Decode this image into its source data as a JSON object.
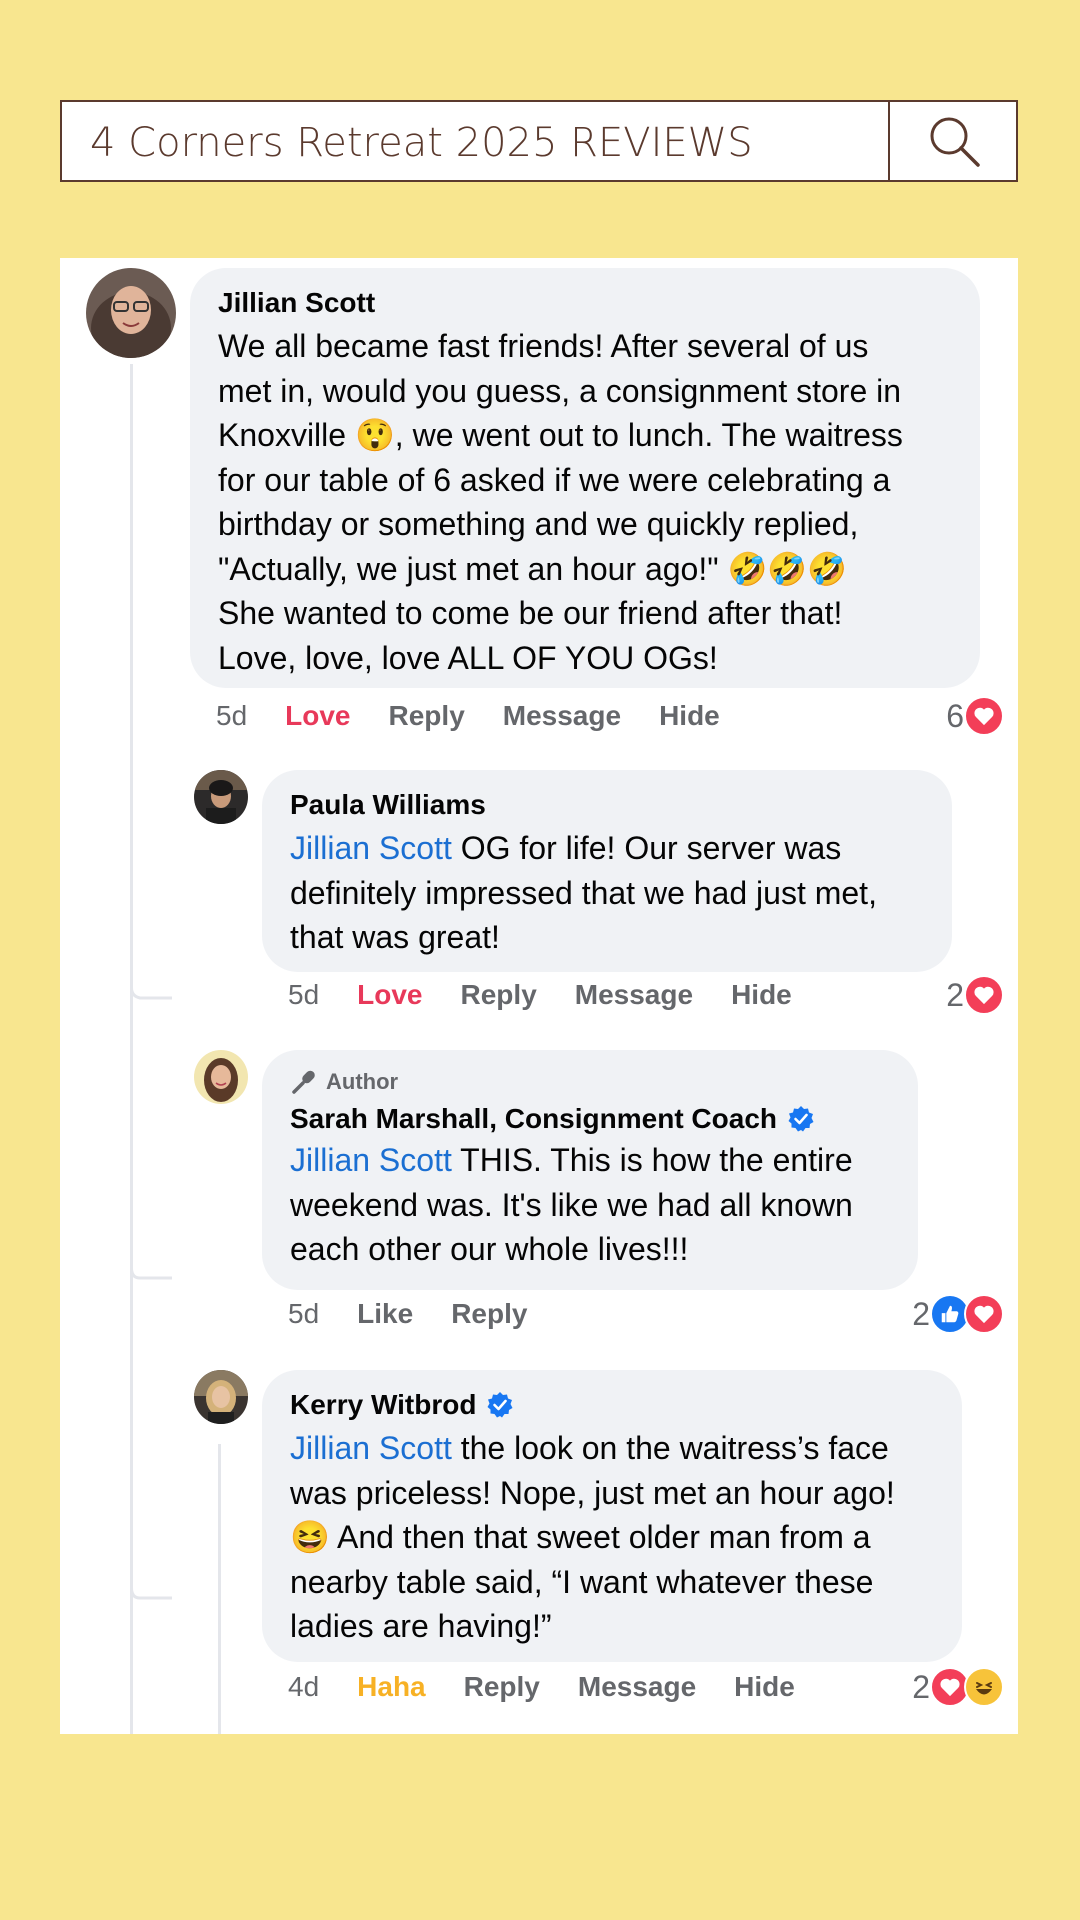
{
  "search": {
    "text": "4 Corners Retreat 2025 REVIEWS"
  },
  "comments": [
    {
      "name": "Jillian Scott",
      "body_lines": [
        "We all became fast friends! After several of us",
        "met in, would you guess, a consignment store in",
        "Knoxville 😲, we went out to lunch. The waitress",
        "for our table of 6 asked if we were celebrating a",
        "birthday or something and we quickly replied,",
        "\"Actually, we just met an hour ago!\" 🤣🤣🤣",
        "She wanted to come be our friend after that!",
        "Love, love, love ALL OF YOU OGs!"
      ],
      "time": "5d",
      "reaction_label": "Love",
      "reply": "Reply",
      "message": "Message",
      "hide": "Hide",
      "reaction_count": "6"
    },
    {
      "name": "Paula Williams",
      "mention": "Jillian Scott",
      "body_first": " OG for life! Our server was",
      "body_lines": [
        "definitely impressed that we had just met,",
        "that was great!"
      ],
      "time": "5d",
      "reaction_label": "Love",
      "reply": "Reply",
      "message": "Message",
      "hide": "Hide",
      "reaction_count": "2"
    },
    {
      "author_tag": "Author",
      "name": "Sarah Marshall, Consignment Coach",
      "mention": "Jillian Scott",
      "body_first": " THIS. This is how the entire",
      "body_lines": [
        "weekend was. It's like we had all known",
        "each other our whole lives!!!"
      ],
      "time": "5d",
      "reaction_label": "Like",
      "reply": "Reply",
      "reaction_count": "2"
    },
    {
      "name": "Kerry Witbrod",
      "mention": "Jillian Scott",
      "body_first": " the look on the waitress’s face",
      "body_lines": [
        "was priceless! Nope, just met an hour ago!",
        "😆 And then that sweet older man from a",
        "nearby table said, “I want whatever these",
        "ladies are having!”"
      ],
      "time": "4d",
      "reaction_label": "Haha",
      "reply": "Reply",
      "message": "Message",
      "hide": "Hide",
      "reaction_count": "2"
    }
  ],
  "colors": {
    "background": "#f8e68f",
    "love": "#e8395a",
    "haha": "#f7b125",
    "mention": "#1b6fd2",
    "like": "#1877f2"
  }
}
